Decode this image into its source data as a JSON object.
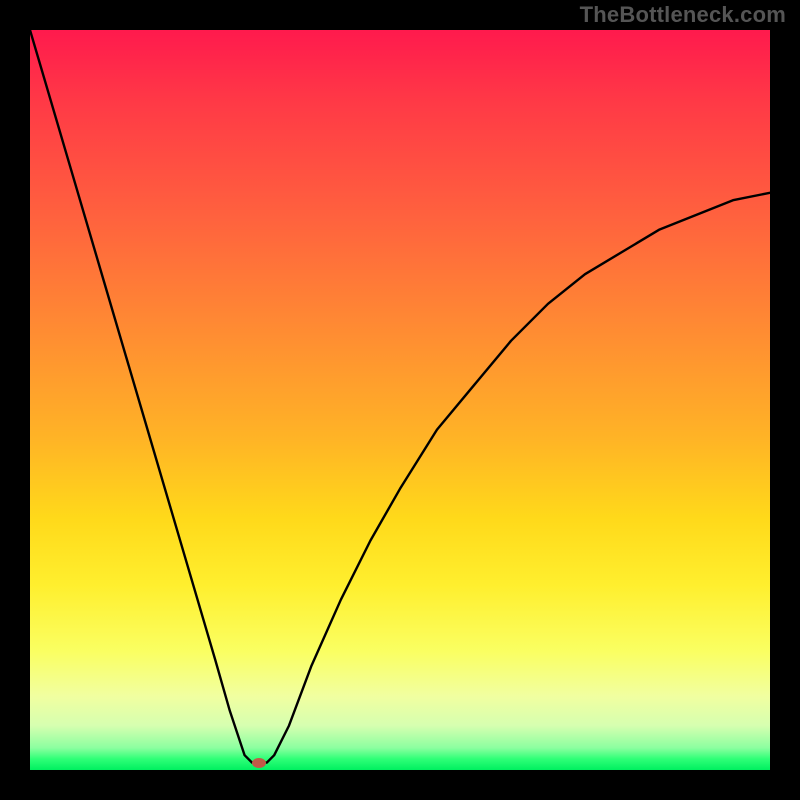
{
  "watermark": "TheBottleneck.com",
  "chart_data": {
    "type": "line",
    "title": "",
    "xlabel": "",
    "ylabel": "",
    "xlim": [
      0,
      100
    ],
    "ylim": [
      0,
      100
    ],
    "series": [
      {
        "name": "bottleneck-curve",
        "x": [
          0,
          5,
          10,
          15,
          20,
          25,
          27,
          29,
          30,
          31,
          32,
          33,
          35,
          38,
          42,
          46,
          50,
          55,
          60,
          65,
          70,
          75,
          80,
          85,
          90,
          95,
          100
        ],
        "y": [
          100,
          83,
          66,
          49,
          32,
          15,
          8,
          2,
          1,
          1,
          1,
          2,
          6,
          14,
          23,
          31,
          38,
          46,
          52,
          58,
          63,
          67,
          70,
          73,
          75,
          77,
          78
        ]
      }
    ],
    "marker": {
      "x": 31,
      "y": 1,
      "color": "#c05a48"
    },
    "gradient_note": "background vertical gradient red→yellow→green (top=high bottleneck, bottom=low)"
  }
}
